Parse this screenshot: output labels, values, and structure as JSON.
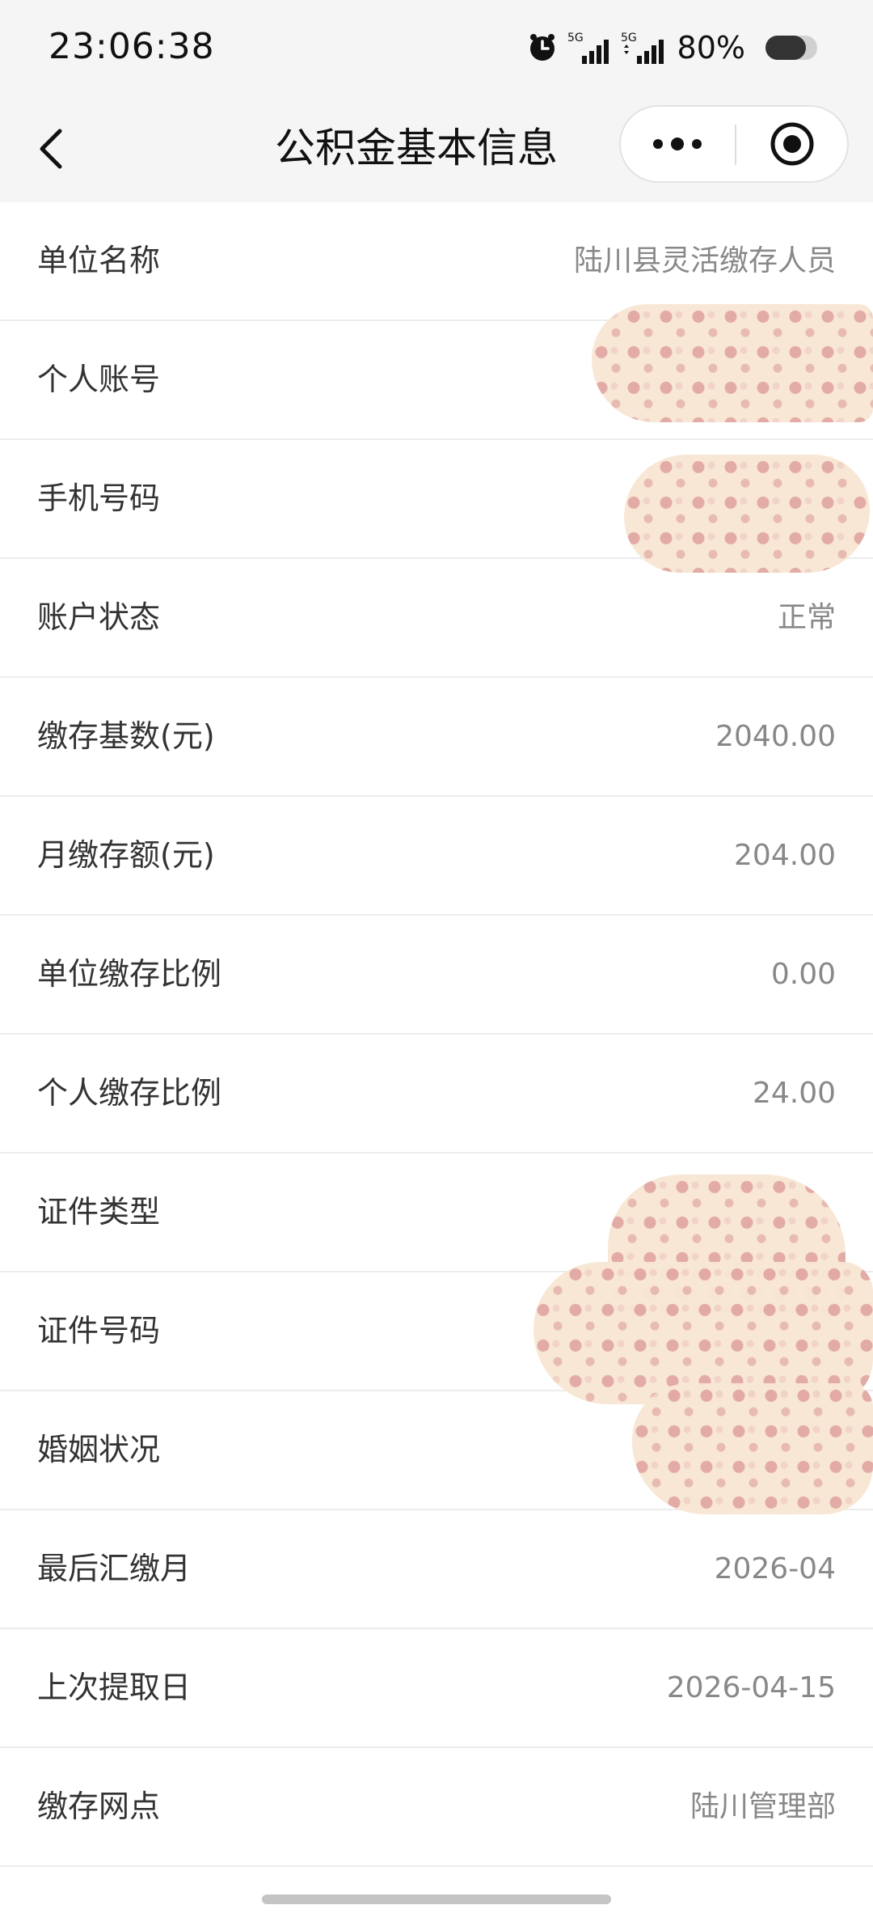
{
  "status_bar": {
    "time": "23:06:38",
    "network_1": "5G",
    "network_2": "5G",
    "battery": "80%"
  },
  "nav": {
    "title": "公积金基本信息"
  },
  "icons": {
    "back": "chevron-left-icon",
    "more": "more-dots-icon",
    "close": "miniprogram-close-icon",
    "alarm": "alarm-icon"
  },
  "rows": [
    {
      "label": "单位名称",
      "value": "陆川县灵活缴存人员"
    },
    {
      "label": "个人账号",
      "value": ""
    },
    {
      "label": "手机号码",
      "value": ""
    },
    {
      "label": "账户状态",
      "value": "正常"
    },
    {
      "label": "缴存基数(元)",
      "value": "2040.00"
    },
    {
      "label": "月缴存额(元)",
      "value": "204.00"
    },
    {
      "label": "单位缴存比例",
      "value": "0.00"
    },
    {
      "label": "个人缴存比例",
      "value": "24.00"
    },
    {
      "label": "证件类型",
      "value": ""
    },
    {
      "label": "证件号码",
      "value": ""
    },
    {
      "label": "婚姻状况",
      "value": ""
    },
    {
      "label": "最后汇缴月",
      "value": "2026-04"
    },
    {
      "label": "上次提取日",
      "value": "2026-04-15"
    },
    {
      "label": "缴存网点",
      "value": "陆川管理部"
    }
  ]
}
